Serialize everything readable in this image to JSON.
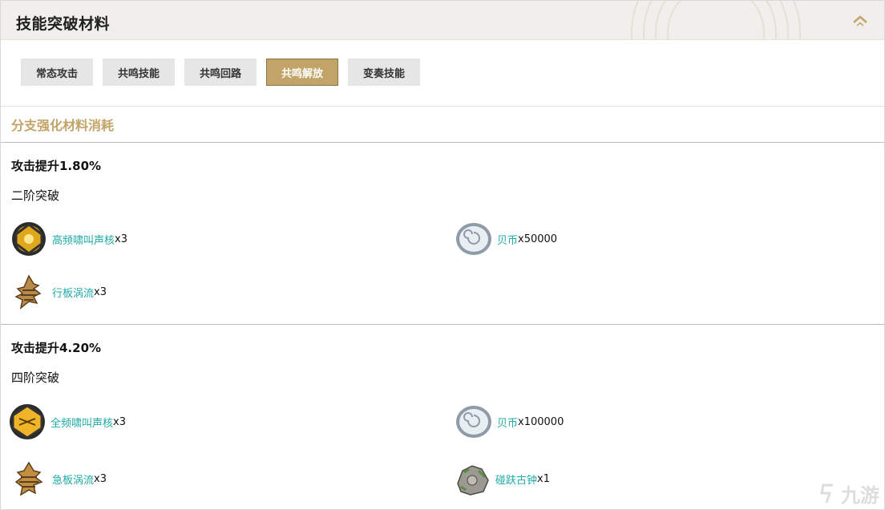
{
  "header": {
    "title": "技能突破材料",
    "collapse_icon": "chevron-up-icon"
  },
  "tabs": [
    {
      "label": "常态攻击",
      "active": false
    },
    {
      "label": "共鸣技能",
      "active": false
    },
    {
      "label": "共鸣回路",
      "active": false
    },
    {
      "label": "共鸣解放",
      "active": true
    },
    {
      "label": "变奏技能",
      "active": false
    }
  ],
  "section": {
    "title": "分支强化材料消耗"
  },
  "levels": [
    {
      "title": "攻击提升1.80%",
      "stage": "二阶突破",
      "items": [
        {
          "name": "高频啸叫声核",
          "qty": "x3",
          "icon": "core-orb-icon"
        },
        {
          "name": "贝币",
          "qty": "x50000",
          "icon": "shell-coin-icon"
        },
        {
          "name": "行板涡流",
          "qty": "x3",
          "icon": "vortex-spiral-icon"
        }
      ]
    },
    {
      "title": "攻击提升4.20%",
      "stage": "四阶突破",
      "items": [
        {
          "name": "全频啸叫声核",
          "qty": "x3",
          "icon": "core-orb-icon"
        },
        {
          "name": "贝币",
          "qty": "x100000",
          "icon": "shell-coin-icon"
        },
        {
          "name": "急板涡流",
          "qty": "x3",
          "icon": "vortex-spiral-icon"
        },
        {
          "name": "碰趺古钟",
          "qty": "x1",
          "icon": "ancient-bell-rock-icon"
        }
      ]
    }
  ],
  "watermark": {
    "text": "九游"
  },
  "colors": {
    "accent_gold": "#c2a368",
    "link_teal": "#1eaaa5",
    "header_bg": "#f1efec",
    "tab_bg": "#e6e6e6"
  }
}
